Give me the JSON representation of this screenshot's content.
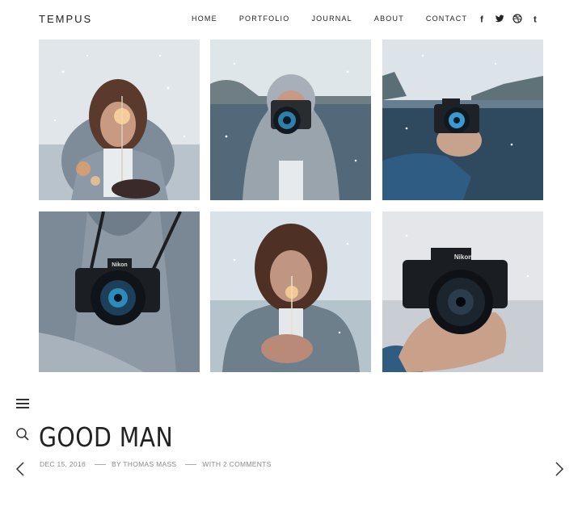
{
  "site": {
    "logo": "TEMPUS"
  },
  "nav": {
    "items": [
      {
        "label": "HOME"
      },
      {
        "label": "PORTFOLIO"
      },
      {
        "label": "JOURNAL"
      },
      {
        "label": "ABOUT"
      },
      {
        "label": "CONTACT"
      }
    ]
  },
  "social": {
    "icons": [
      "facebook-icon",
      "twitter-icon",
      "dribbble-icon",
      "tumblr-icon"
    ],
    "facebook": "f",
    "tumblr": "t"
  },
  "gallery": {
    "images": [
      "woman-with-sparkler-snow",
      "hooded-person-with-camera-lake",
      "hand-holding-camera-over-lake",
      "camera-strap-on-knit-sweater",
      "woman-holding-sparkler-blurred",
      "hand-holding-nikon-camera"
    ],
    "camera_brand": "Nikon"
  },
  "post": {
    "title": "GOOD MAN",
    "date": "DEC 15, 2016",
    "author": "BY THOMAS MASS",
    "comments": "WITH 2 COMMENTS"
  },
  "colors": {
    "text": "#222222",
    "meta": "#8a8a8a",
    "sky": "#dde5ea",
    "water": "#3a5368",
    "sweater": "#8b98a6",
    "jacket": "#2f5c80"
  }
}
